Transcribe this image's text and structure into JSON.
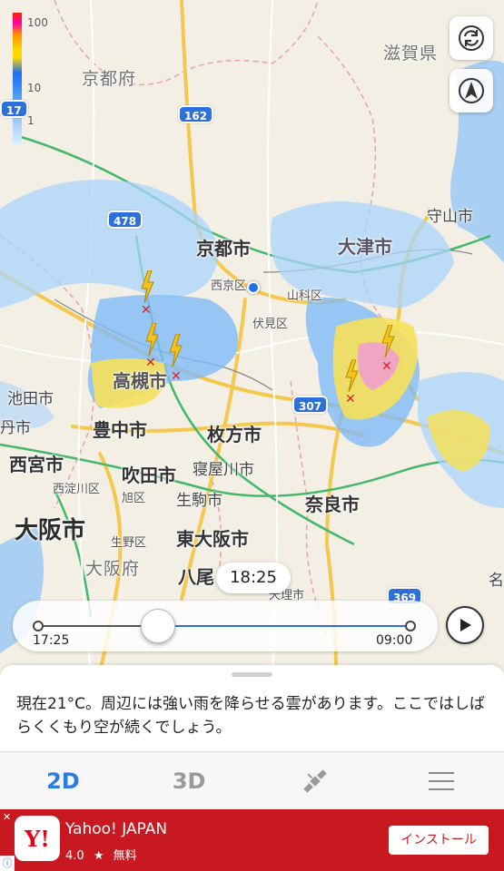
{
  "legend": {
    "ticks": [
      "100",
      "10",
      "1"
    ]
  },
  "map": {
    "labels": {
      "kyoto_fu": "京都府",
      "shiga_ken": "滋賀県",
      "kyoto_shi": "京都市",
      "otsu_shi": "大津市",
      "moriyama_shi": "守山市",
      "nishikyo_ku": "西京区",
      "yamashina_ku": "山科区",
      "fushimi_ku": "伏見区",
      "takatsuki_shi": "高槻市",
      "ikeda_shi": "池田市",
      "itami_shi": "丹市",
      "toyonaka_shi": "豊中市",
      "hirakata_shi": "枚方市",
      "nishinomiya_shi": "西宮市",
      "suita_shi": "吹田市",
      "neyagawa_shi": "寝屋川市",
      "nishiyodogawa_ku": "西淀川区",
      "asahi_ku": "旭区",
      "ikoma_shi": "生駒市",
      "nara_shi": "奈良市",
      "osaka_shi": "大阪市",
      "ikuno_ku": "生野区",
      "higashiosaka_shi": "東大阪市",
      "osaka_fu": "大阪府",
      "yao": "八尾",
      "tenri_shi": "天理市",
      "na": "名"
    },
    "roads": [
      "162",
      "478",
      "307",
      "369",
      "17"
    ]
  },
  "time_badge": "18:25",
  "timeline": {
    "start": "17:25",
    "end": "09:00",
    "progress": 0.32
  },
  "sheet": {
    "message": "現在21°C。周辺には強い雨を降らせる雲があります。ここではしばらくくもり空が続くでしょう。"
  },
  "tabs": [
    {
      "label": "2D",
      "active": true
    },
    {
      "label": "3D",
      "active": false
    },
    {
      "icon": "satellite-icon"
    },
    {
      "icon": "menu-icon"
    }
  ],
  "ad": {
    "title": "Yahoo! JAPAN",
    "rating": "4.0",
    "star": "★",
    "price": "無料",
    "install": "インストール",
    "logo_text": "Y!",
    "info": "ⓘ",
    "close": "✕"
  },
  "colors": {
    "accent": "#2a7de1",
    "ad_bg": "#c81820",
    "lightning": "#f6c21c"
  }
}
